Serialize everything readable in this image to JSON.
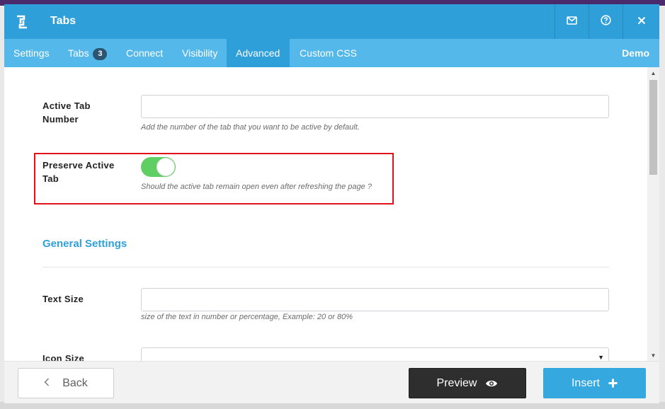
{
  "window": {
    "title": "Tabs"
  },
  "titlebar_icons": {
    "logo": "brackets-logo-icon",
    "mail": "mail-icon",
    "help": "help-circle-icon",
    "close": "close-icon"
  },
  "tabs": [
    {
      "label": "Settings",
      "active": false
    },
    {
      "label": "Tabs",
      "count": "3",
      "active": false
    },
    {
      "label": "Connect",
      "active": false
    },
    {
      "label": "Visibility",
      "active": false
    },
    {
      "label": "Advanced",
      "active": true
    },
    {
      "label": "Custom CSS",
      "active": false
    }
  ],
  "demo_label": "Demo",
  "form": {
    "active_tab_number": {
      "label_line1": "Active Tab",
      "label_line2": "Number",
      "value": "",
      "help": "Add the number of the tab that you want to be active by default."
    },
    "preserve_active_tab": {
      "label_line1": "Preserve Active",
      "label_line2": "Tab",
      "enabled": true,
      "help": "Should the active tab remain open even after refreshing the page ?"
    },
    "general_settings_title": "General Settings",
    "text_size": {
      "label": "Text Size",
      "value": "",
      "help": "size of the text in number or percentage, Example: 20 or 80%"
    },
    "icon_size": {
      "label": "Icon Size",
      "value": ""
    }
  },
  "footer": {
    "back_label": "Back",
    "preview_label": "Preview",
    "insert_label": "Insert"
  },
  "colors": {
    "primary": "#2f9fd9",
    "tab_bar": "#55b8ea",
    "toggle_on": "#5fcf63",
    "highlight": "#e0111a",
    "preview_button": "#2e2e2e",
    "insert_button": "#35a8e0"
  }
}
